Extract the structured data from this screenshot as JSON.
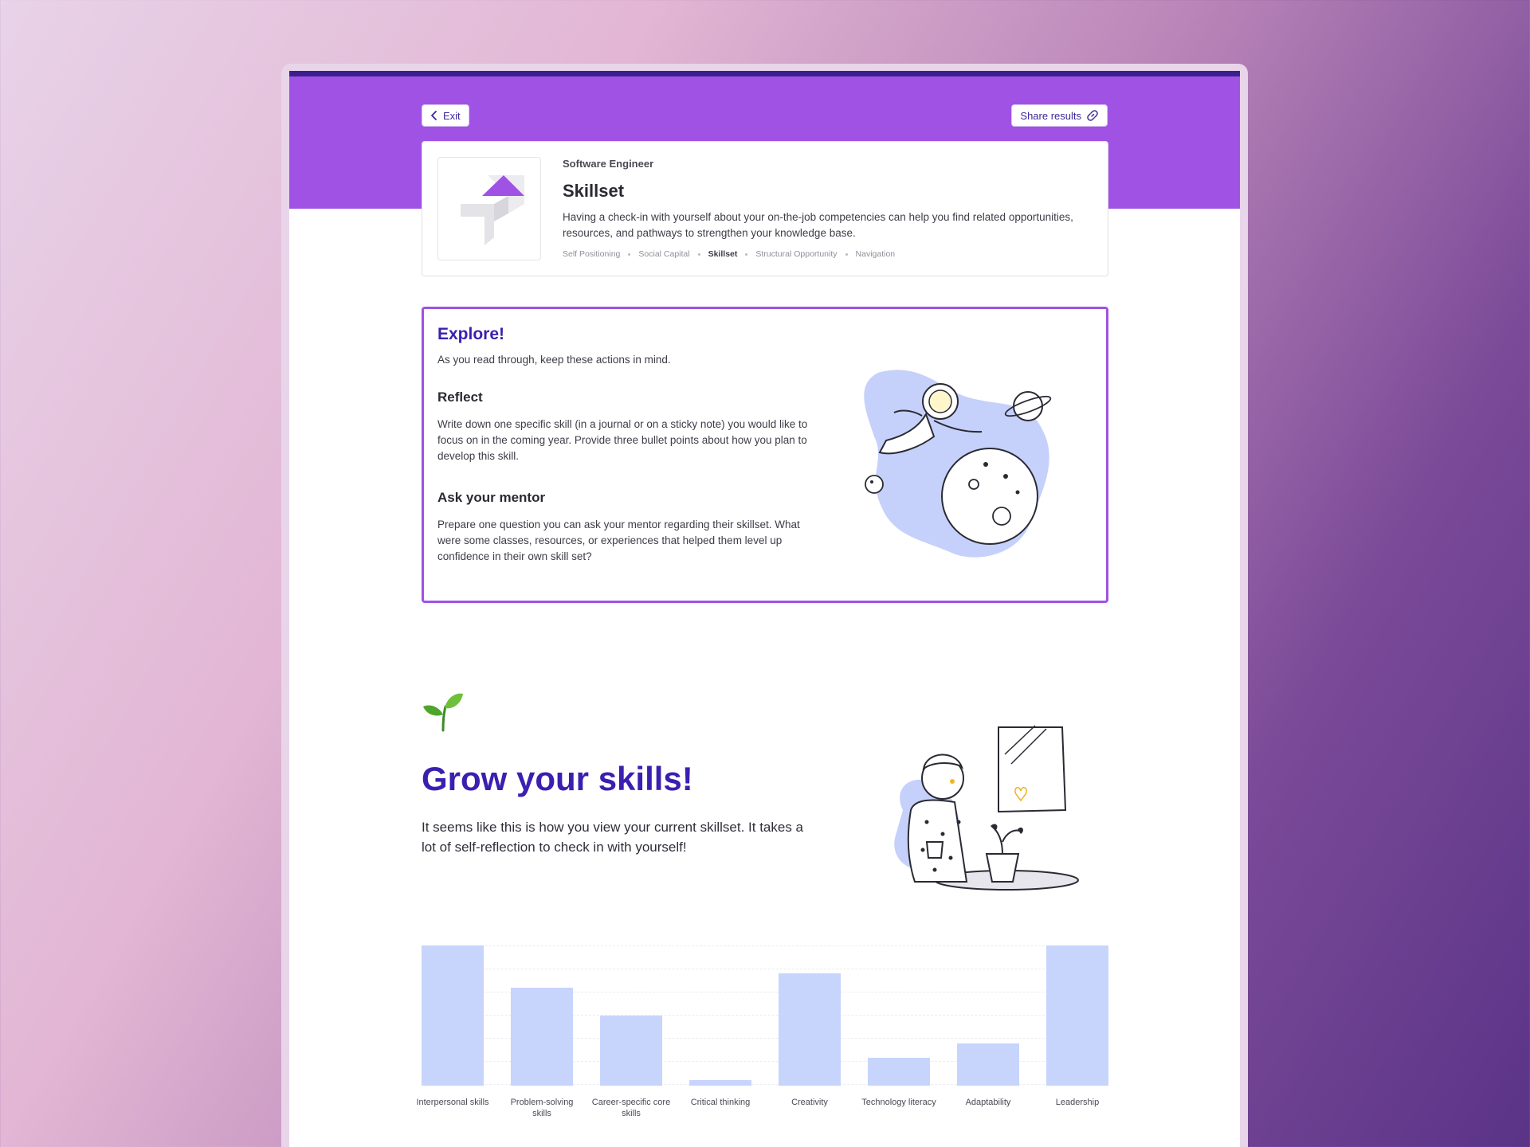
{
  "header": {
    "exit_label": "Exit",
    "share_label": "Share results"
  },
  "card": {
    "eyebrow": "Software Engineer",
    "title": "Skillset",
    "description": "Having a check-in with yourself about your on-the-job competencies can help you find related opportunities, resources, and pathways to strengthen your knowledge base.",
    "crumbs": [
      "Self Positioning",
      "Social Capital",
      "Skillset",
      "Structural Opportunity",
      "Navigation"
    ]
  },
  "explore": {
    "title": "Explore!",
    "intro": "As you read through, keep these actions in mind.",
    "reflect_title": "Reflect",
    "reflect_body": "Write down one specific skill (in a journal or on a sticky note) you would like to focus on in the coming year. Provide three bullet points about how you plan to develop this skill.",
    "mentor_title": "Ask your mentor",
    "mentor_body": "Prepare one question you can ask your mentor regarding their skillset. What were some classes, resources, or experiences that helped them level up confidence in their own skill set?"
  },
  "grow": {
    "title": "Grow your skills!",
    "body": "It seems like this is how you view your current skillset. It takes a lot of self-reflection to check in with yourself!"
  },
  "colors": {
    "hero": "#a052e4",
    "accent": "#3b1fb0",
    "bar": "#c7d5fd"
  },
  "chart_data": {
    "type": "bar",
    "categories": [
      "Interpersonal skills",
      "Problem-solving skills",
      "Career-specific core skills",
      "Critical thinking",
      "Creativity",
      "Technology literacy",
      "Adaptability",
      "Leadership"
    ],
    "values": [
      100,
      70,
      50,
      4,
      80,
      20,
      30,
      100
    ],
    "ylim": [
      0,
      100
    ],
    "grid": true
  }
}
